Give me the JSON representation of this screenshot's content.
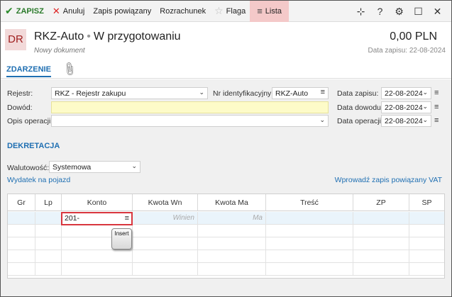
{
  "toolbar": {
    "save": "ZAPISZ",
    "cancel": "Anuluj",
    "linked_entry": "Zapis powiązany",
    "settlement": "Rozrachunek",
    "flag": "Flaga",
    "list": "Lista"
  },
  "header": {
    "badge": "DR",
    "title": "RKZ-Auto",
    "status": "W przygotowaniu",
    "subtitle": "Nowy dokument",
    "amount": "0,00 PLN",
    "record_date": "Data zapisu: 22-08-2024"
  },
  "tabs": {
    "active": "ZDARZENIE"
  },
  "form": {
    "register_label": "Rejestr:",
    "register_value": "RKZ - Rejestr zakupu",
    "id_label": "Nr identyfikacyjny:",
    "id_value": "RKZ-Auto",
    "record_date_label": "Data zapisu:",
    "record_date_value": "22-08-2024",
    "proof_label": "Dowód:",
    "proof_value": "",
    "proof_date_label": "Data dowodu:",
    "proof_date_value": "22-08-2024",
    "op_desc_label": "Opis operacji:",
    "op_desc_value": "",
    "op_date_label": "Data operacji:",
    "op_date_value": "22-08-2024"
  },
  "decree": {
    "section": "DEKRETACJA",
    "currency_label": "Walutowość:",
    "currency_value": "Systemowa",
    "link_left": "Wydatek na pojazd",
    "link_right": "Wprowadź zapis powiązany VAT"
  },
  "grid": {
    "columns": [
      "Gr",
      "Lp",
      "Konto",
      "Kwota Wn",
      "Kwota Ma",
      "Treść",
      "ZP",
      "SP"
    ],
    "edit_value": "201-",
    "wn_placeholder": "Winien",
    "ma_placeholder": "Ma",
    "insert_key": "Insert"
  }
}
